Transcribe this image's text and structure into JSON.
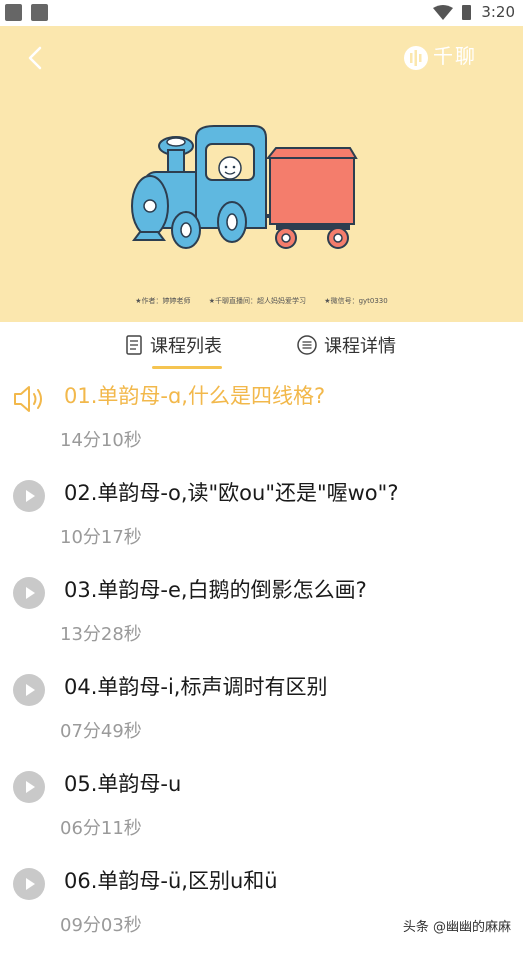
{
  "status_bar": {
    "time": "3:20"
  },
  "banner": {
    "brand": "千聊",
    "credits": [
      "★作者：婷婷老师",
      "★千聊直播间：超人妈妈爱学习",
      "★微信号：gyt0330"
    ]
  },
  "tabs": [
    {
      "label": "课程列表",
      "active": true
    },
    {
      "label": "课程详情",
      "active": false
    }
  ],
  "lessons": [
    {
      "title": "01.单韵母-ɑ,什么是四线格?",
      "duration": "14分10秒",
      "playing": true
    },
    {
      "title": "02.单韵母-o,读\"欧ou\"还是\"喔wo\"?",
      "duration": "10分17秒",
      "playing": false
    },
    {
      "title": "03.单韵母-e,白鹅的倒影怎么画?",
      "duration": "13分28秒",
      "playing": false
    },
    {
      "title": "04.单韵母-i,标声调时有区别",
      "duration": "07分49秒",
      "playing": false
    },
    {
      "title": "05.单韵母-u",
      "duration": "06分11秒",
      "playing": false
    },
    {
      "title": "06.单韵母-ü,区别u和ü",
      "duration": "09分03秒",
      "playing": false
    }
  ],
  "watermark": "头条 @幽幽的麻麻",
  "colors": {
    "accent": "#f2b84b",
    "banner_bg": "#fbe7ae",
    "play_icon": "#c9c9c9"
  }
}
